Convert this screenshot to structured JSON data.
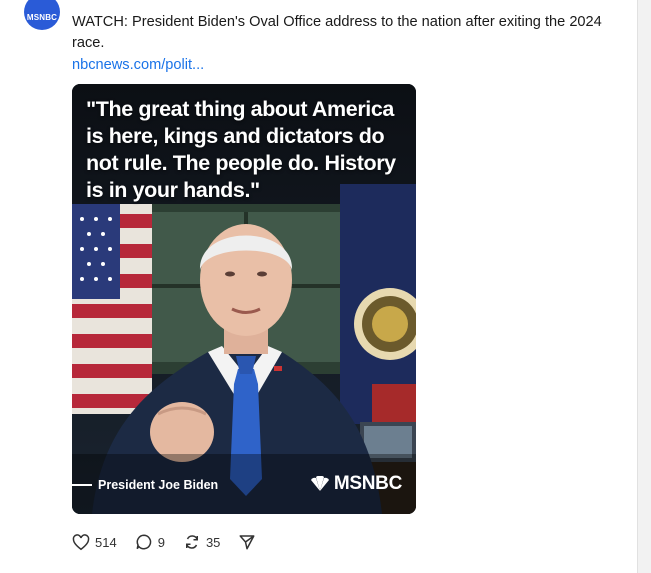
{
  "post": {
    "avatar_label": "MSNBC",
    "text": "WATCH: President Biden's Oval Office address to the nation after exiting the 2024 race.",
    "link": "nbcnews.com/polit..."
  },
  "media": {
    "quote": "\"The great thing about America is here, kings and dictators do not rule. The people do. History is in your hands.\"",
    "caption": "President Joe Biden",
    "brand": "MSNBC"
  },
  "actions": {
    "likes": "514",
    "replies": "9",
    "reposts": "35"
  },
  "colors": {
    "link": "#1a73e8",
    "avatar": "#2a5bd7",
    "suit": "#1c2a44",
    "tie": "#2f63c9"
  },
  "icons": [
    "heart-icon",
    "reply-icon",
    "repost-icon",
    "share-icon",
    "peacock-icon"
  ]
}
